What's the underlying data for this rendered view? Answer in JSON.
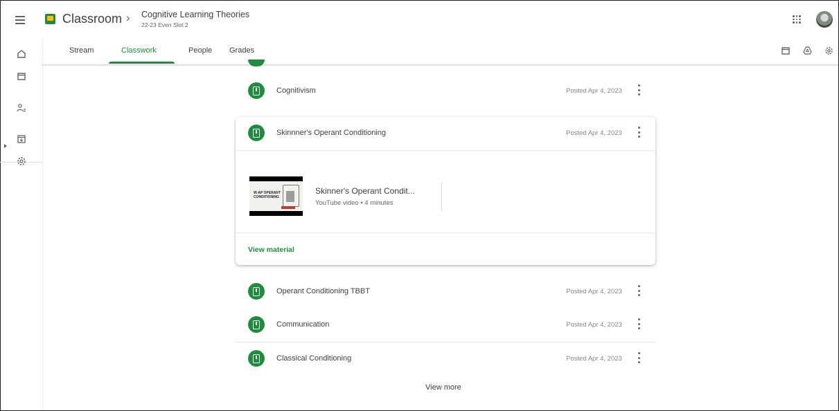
{
  "header": {
    "app_name": "Classroom",
    "breadcrumb_separator": "›",
    "class_title": "Cognitive Learning Theories",
    "class_subtitle": "22-23 Even Slot 2"
  },
  "tabs": [
    {
      "label": "Stream",
      "active": false
    },
    {
      "label": "Classwork",
      "active": true
    },
    {
      "label": "People",
      "active": false
    },
    {
      "label": "Grades",
      "active": false
    }
  ],
  "rail_icons": [
    "home-icon",
    "calendar-icon",
    "people-icon",
    "archive-icon",
    "settings-icon"
  ],
  "top_right_icons": [
    "calendar-icon",
    "drive-icon",
    "settings-icon"
  ],
  "items": [
    {
      "title": "Cognitivism",
      "posted": "Posted Apr 4, 2023"
    },
    {
      "title": "Skinnner's Operant Conditioning",
      "posted": "Posted Apr 4, 2023"
    },
    {
      "title": "Operant Conditioning TBBT",
      "posted": "Posted Apr 4, 2023"
    },
    {
      "title": "Communication",
      "posted": "Posted Apr 4, 2023"
    },
    {
      "title": "Classical Conditioning",
      "posted": "Posted Apr 4, 2023"
    }
  ],
  "attachment": {
    "title": "Skinner's Operant Condit...",
    "subtitle": "YouTube video • 4 minutes",
    "thumbnail_text": "W-AP OPERANT CONDITIONING"
  },
  "view_material_label": "View material",
  "view_more_label": "View more",
  "colors": {
    "accent": "#1e8e3e",
    "text": "#3c4043",
    "muted": "#80868b"
  }
}
